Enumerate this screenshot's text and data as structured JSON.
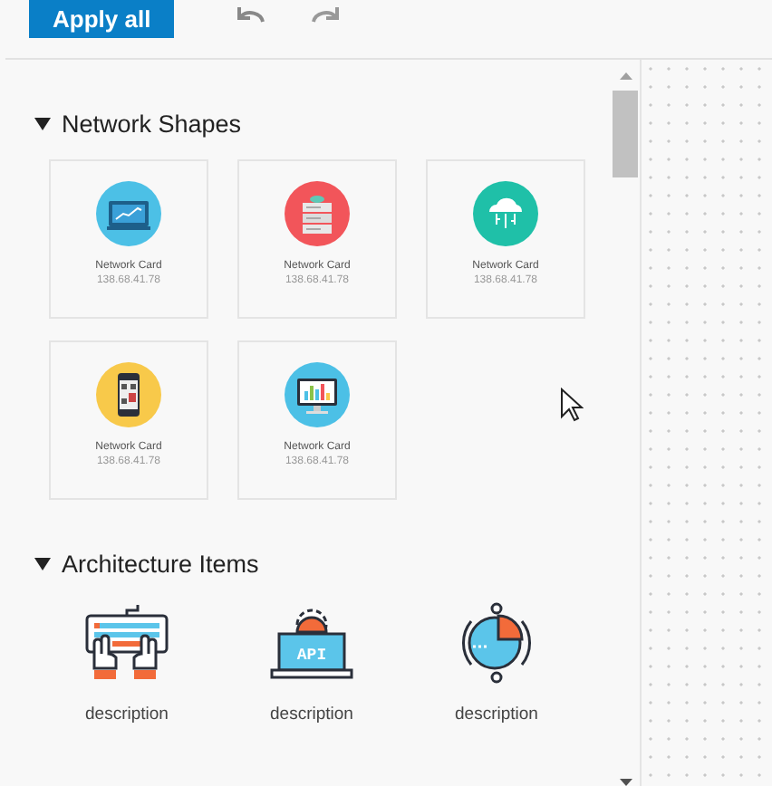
{
  "toolbar": {
    "apply_button": "Apply all"
  },
  "sections": [
    {
      "title": "Network Shapes",
      "expanded": true,
      "items": [
        {
          "kind": "card",
          "title": "Network Card",
          "subtitle": "138.68.41.78"
        },
        {
          "kind": "card",
          "title": "Network Card",
          "subtitle": "138.68.41.78"
        },
        {
          "kind": "card",
          "title": "Network Card",
          "subtitle": "138.68.41.78"
        },
        {
          "kind": "card",
          "title": "Network Card",
          "subtitle": "138.68.41.78"
        },
        {
          "kind": "card",
          "title": "Network Card",
          "subtitle": "138.68.41.78"
        }
      ]
    },
    {
      "title": "Architecture Items",
      "expanded": true,
      "items": [
        {
          "kind": "symbol",
          "label": "description"
        },
        {
          "kind": "symbol",
          "label": "description",
          "icon_text": "API"
        },
        {
          "kind": "symbol",
          "label": "description"
        }
      ]
    }
  ]
}
